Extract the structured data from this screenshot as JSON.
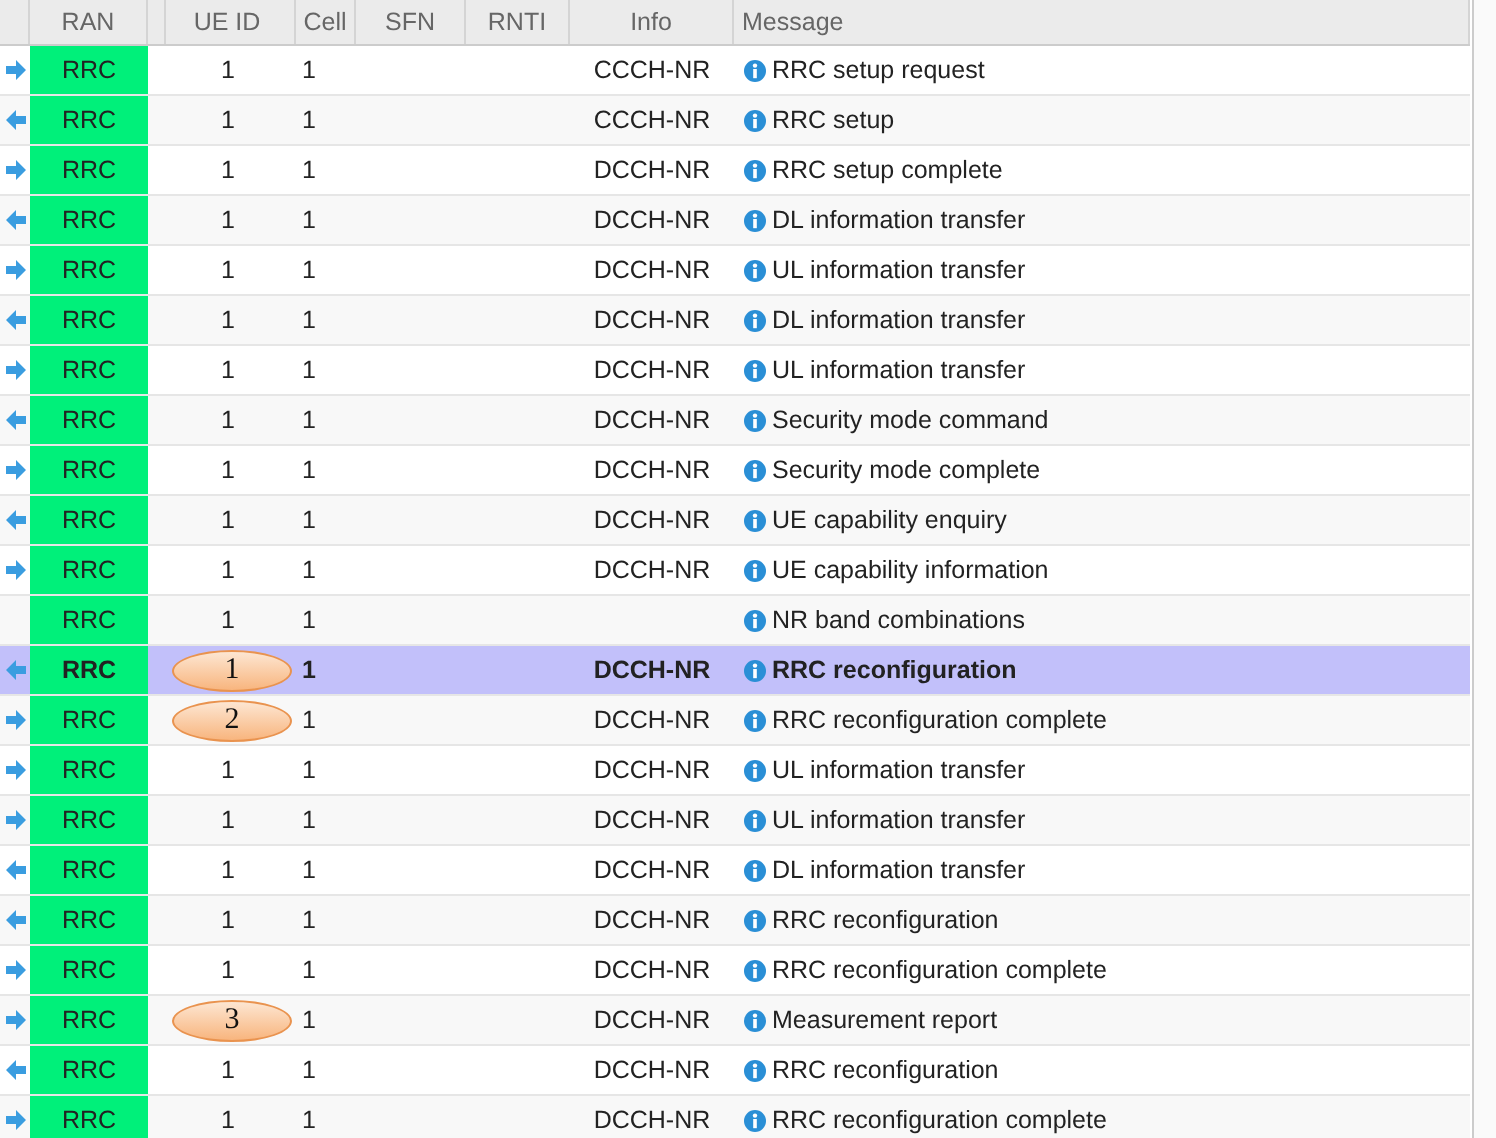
{
  "columns": [
    "RAN",
    "UE ID",
    "Cell",
    "SFN",
    "RNTI",
    "Info",
    "Message"
  ],
  "rows": [
    {
      "kind": "uplink",
      "ran": "RRC",
      "ue_id": "1",
      "cell": "1",
      "info": "CCCH-NR",
      "message": "RRC setup request",
      "selected": false
    },
    {
      "kind": "downlink",
      "ran": "RRC",
      "ue_id": "1",
      "cell": "1",
      "info": "CCCH-NR",
      "message": "RRC setup",
      "selected": false
    },
    {
      "kind": "uplink",
      "ran": "RRC",
      "ue_id": "1",
      "cell": "1",
      "info": "DCCH-NR",
      "message": "RRC setup complete",
      "selected": false
    },
    {
      "kind": "downlink",
      "ran": "RRC",
      "ue_id": "1",
      "cell": "1",
      "info": "DCCH-NR",
      "message": "DL information transfer",
      "selected": false
    },
    {
      "kind": "uplink",
      "ran": "RRC",
      "ue_id": "1",
      "cell": "1",
      "info": "DCCH-NR",
      "message": "UL information transfer",
      "selected": false
    },
    {
      "kind": "downlink",
      "ran": "RRC",
      "ue_id": "1",
      "cell": "1",
      "info": "DCCH-NR",
      "message": "DL information transfer",
      "selected": false
    },
    {
      "kind": "uplink",
      "ran": "RRC",
      "ue_id": "1",
      "cell": "1",
      "info": "DCCH-NR",
      "message": "UL information transfer",
      "selected": false
    },
    {
      "kind": "downlink",
      "ran": "RRC",
      "ue_id": "1",
      "cell": "1",
      "info": "DCCH-NR",
      "message": "Security mode command",
      "selected": false
    },
    {
      "kind": "uplink",
      "ran": "RRC",
      "ue_id": "1",
      "cell": "1",
      "info": "DCCH-NR",
      "message": "Security mode complete",
      "selected": false
    },
    {
      "kind": "downlink",
      "ran": "RRC",
      "ue_id": "1",
      "cell": "1",
      "info": "DCCH-NR",
      "message": "UE capability enquiry",
      "selected": false
    },
    {
      "kind": "uplink",
      "ran": "RRC",
      "ue_id": "1",
      "cell": "1",
      "info": "DCCH-NR",
      "message": "UE capability information",
      "selected": false
    },
    {
      "kind": "internal",
      "ran": "RRC",
      "ue_id": "1",
      "cell": "1",
      "message": "NR band combinations",
      "selected": false
    },
    {
      "kind": "downlink",
      "ran": "RRC",
      "callout": "1",
      "cell": "1",
      "info": "DCCH-NR",
      "message": "RRC reconfiguration",
      "selected": true
    },
    {
      "kind": "uplink",
      "ran": "RRC",
      "callout": "2",
      "cell": "1",
      "info": "DCCH-NR",
      "message": "RRC reconfiguration complete",
      "selected": false
    },
    {
      "kind": "uplink",
      "ran": "RRC",
      "ue_id": "1",
      "cell": "1",
      "info": "DCCH-NR",
      "message": "UL information transfer",
      "selected": false
    },
    {
      "kind": "uplink",
      "ran": "RRC",
      "ue_id": "1",
      "cell": "1",
      "info": "DCCH-NR",
      "message": "UL information transfer",
      "selected": false
    },
    {
      "kind": "downlink",
      "ran": "RRC",
      "ue_id": "1",
      "cell": "1",
      "info": "DCCH-NR",
      "message": "DL information transfer",
      "selected": false
    },
    {
      "kind": "downlink",
      "ran": "RRC",
      "ue_id": "1",
      "cell": "1",
      "info": "DCCH-NR",
      "message": "RRC reconfiguration",
      "selected": false
    },
    {
      "kind": "uplink",
      "ran": "RRC",
      "ue_id": "1",
      "cell": "1",
      "info": "DCCH-NR",
      "message": "RRC reconfiguration complete",
      "selected": false
    },
    {
      "kind": "uplink",
      "ran": "RRC",
      "callout": "3",
      "cell": "1",
      "info": "DCCH-NR",
      "message": "Measurement report",
      "selected": false
    },
    {
      "kind": "downlink",
      "ran": "RRC",
      "ue_id": "1",
      "cell": "1",
      "info": "DCCH-NR",
      "message": "RRC reconfiguration",
      "selected": false
    },
    {
      "kind": "uplink",
      "ran": "RRC",
      "ue_id": "1",
      "cell": "1",
      "info": "DCCH-NR",
      "message": "RRC reconfiguration complete",
      "selected": false
    }
  ]
}
